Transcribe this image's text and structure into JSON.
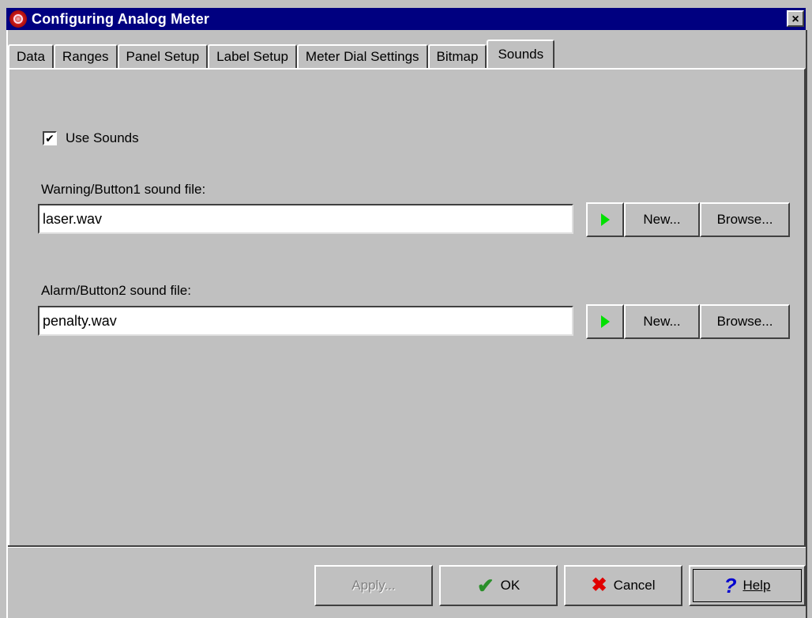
{
  "window": {
    "title": "Configuring Analog Meter",
    "close_label": "×"
  },
  "tabs": [
    {
      "label": "Data"
    },
    {
      "label": "Ranges"
    },
    {
      "label": "Panel Setup"
    },
    {
      "label": "Label Setup"
    },
    {
      "label": "Meter Dial Settings"
    },
    {
      "label": "Bitmap"
    },
    {
      "label": "Sounds",
      "active": true
    }
  ],
  "sounds": {
    "use_sounds_label": "Use Sounds",
    "use_sounds_checked": true,
    "warning": {
      "label": "Warning/Button1 sound file:",
      "value": "laser.wav",
      "new_label": "New...",
      "browse_label": "Browse..."
    },
    "alarm": {
      "label": "Alarm/Button2 sound file:",
      "value": "penalty.wav",
      "new_label": "New...",
      "browse_label": "Browse..."
    }
  },
  "footer": {
    "apply_label": "Apply...",
    "ok_label": "OK",
    "cancel_label": "Cancel",
    "help_label": "Help"
  },
  "colors": {
    "titlebar": "#000080",
    "face": "#c0c0c0",
    "play": "#00e000"
  }
}
